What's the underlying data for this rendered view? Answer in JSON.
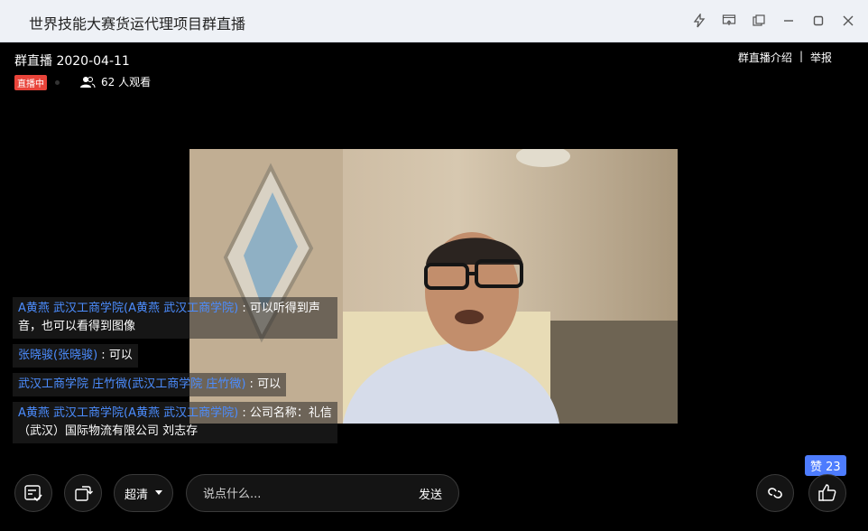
{
  "window": {
    "title": "世界技能大赛货运代理项目群直播",
    "controls": [
      "lightning-icon",
      "screen-share-icon",
      "popout-icon",
      "minimize-icon",
      "maximize-icon",
      "close-icon"
    ]
  },
  "live": {
    "title": "群直播 2020-04-11",
    "badge": "直播中",
    "viewers": "62 人观看",
    "intro_link": "群直播介绍",
    "separator": "|",
    "report_link": "举报"
  },
  "chat": [
    {
      "user": "A黄燕 武汉工商学院(A黄燕 武汉工商学院)",
      "text": " : 可以听得到声音，也可以看得到图像"
    },
    {
      "user": "张晓骏(张晓骏)",
      "text": " : 可以"
    },
    {
      "user": "武汉工商学院 庄竹微(武汉工商学院 庄竹微)",
      "text": " : 可以"
    },
    {
      "user": "A黄燕 武汉工商学院(A黄燕 武汉工商学院)",
      "text": " : 公司名称：礼信（武汉）国际物流有限公司 刘志存"
    }
  ],
  "bottom": {
    "quality": "超清",
    "comment_placeholder": "说点什么...",
    "send": "发送",
    "like_count": "赞 23"
  },
  "colors": {
    "badge": "#e8443a",
    "chat_user": "#4c8dff",
    "like_badge": "#4d7cfe"
  }
}
